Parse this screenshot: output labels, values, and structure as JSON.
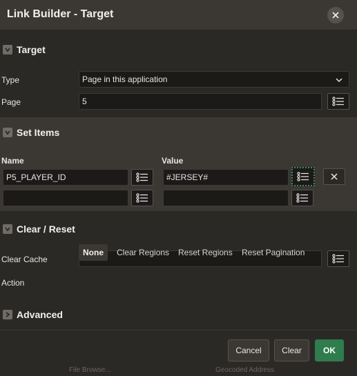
{
  "dialog": {
    "title": "Link Builder - Target"
  },
  "target": {
    "section_title": "Target",
    "type_label": "Type",
    "type_value": "Page in this application",
    "page_label": "Page",
    "page_value": "5"
  },
  "set_items": {
    "section_title": "Set Items",
    "name_header": "Name",
    "value_header": "Value",
    "rows": [
      {
        "name": "P5_PLAYER_ID",
        "value": "#JERSEY#"
      },
      {
        "name": "",
        "value": ""
      }
    ]
  },
  "clear_reset": {
    "section_title": "Clear / Reset",
    "clear_cache_label": "Clear Cache",
    "clear_cache_value": "",
    "action_label": "Action",
    "actions": [
      "None",
      "Clear Regions",
      "Reset Regions",
      "Reset Pagination"
    ],
    "selected_action": "None"
  },
  "advanced": {
    "section_title": "Advanced"
  },
  "footer": {
    "cancel_label": "Cancel",
    "clear_label": "Clear",
    "ok_label": "OK"
  },
  "background": {
    "left_text": "File Browse...",
    "right_text": "Geocoded Address"
  },
  "colors": {
    "accent": "#2f7d4c",
    "panel": "#3b3834",
    "body": "#2b2926",
    "field": "#1c1a18"
  },
  "icons": {
    "close": "close-icon",
    "list": "list-icon",
    "remove": "remove-icon",
    "caret": "chevron-down-icon",
    "expanded": "chevron-down-icon",
    "collapsed": "chevron-right-icon"
  }
}
